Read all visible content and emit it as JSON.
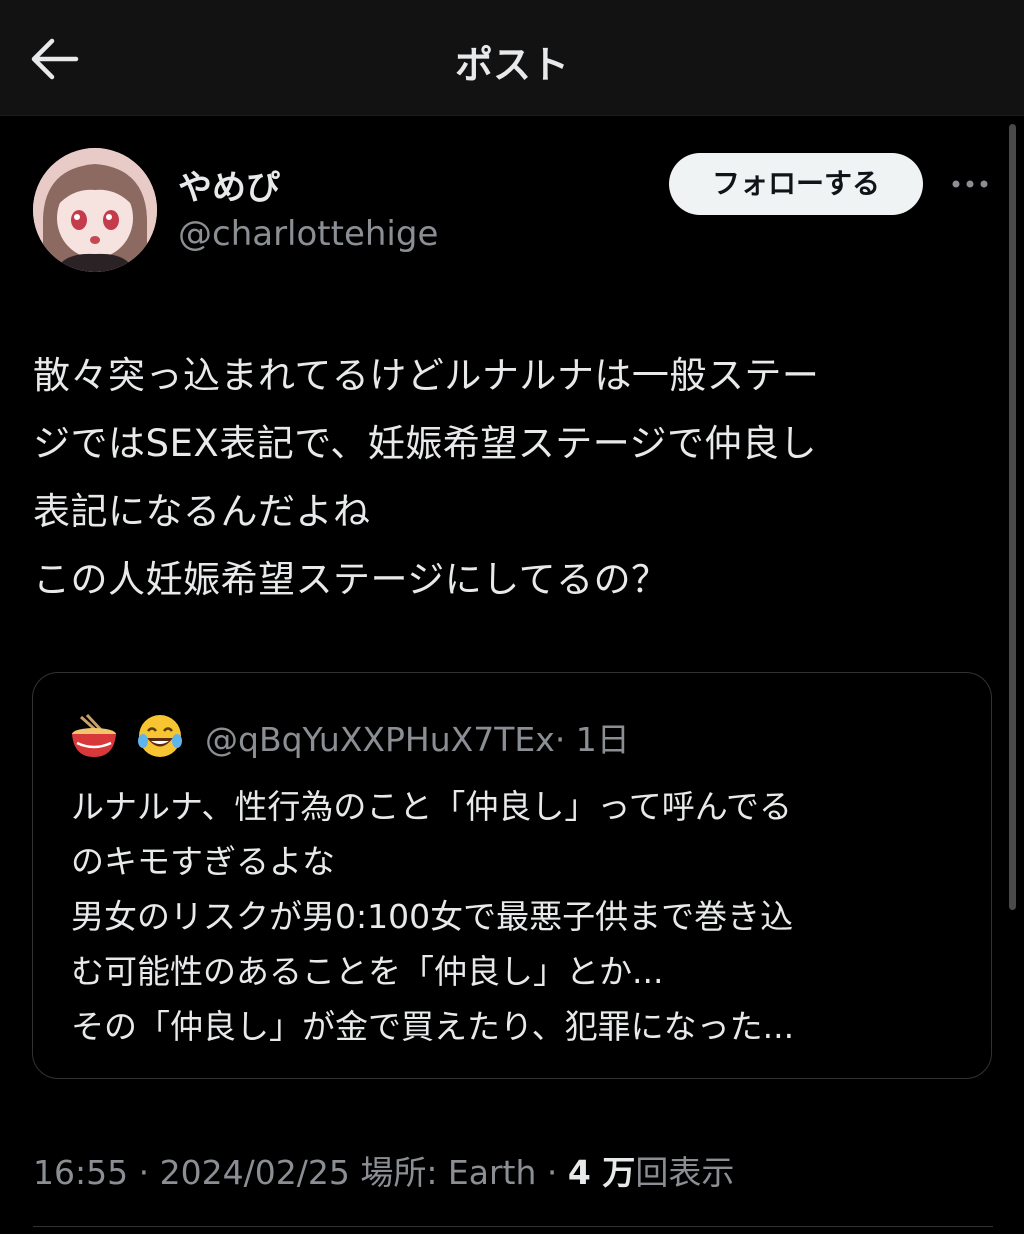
{
  "header": {
    "title": "ポスト"
  },
  "author": {
    "display_name": "やめぴ",
    "handle": "@charlottehige",
    "follow_label": "フォローする"
  },
  "post": {
    "text": "散々突っ込まれてるけどルナルナは一般ステー\nジではSEX表記で、妊娠希望ステージで仲良し\n表記になるんだよね\nこの人妊娠希望ステージにしてるの？"
  },
  "quoted_post": {
    "author_emojis": [
      "noodle-bowl-emoji",
      "tears-of-joy-emoji"
    ],
    "handle": "@qBqYuXXPHuX7TEx",
    "time": "· 1日",
    "text": "ルナルナ、性行為のこと「仲良し」って呼んでる\nのキモすぎるよな\n男女のリスクが男0:100女で最悪子供まで巻き込\nむ可能性のあることを「仲良し」とか...\nその「仲良し」が金で買えたり、犯罪になった..."
  },
  "meta": {
    "time": "16:55",
    "date": "2024/02/25",
    "location": "場所: Earth",
    "views_count": "4 万",
    "views_label": "回表示",
    "separator": "·"
  },
  "colors": {
    "background": "#000000",
    "header_bg": "#121212",
    "text_primary": "#e7e9ea",
    "text_secondary": "#8b8f94",
    "follow_button_bg": "#eff3f4",
    "border": "#2f3336"
  }
}
